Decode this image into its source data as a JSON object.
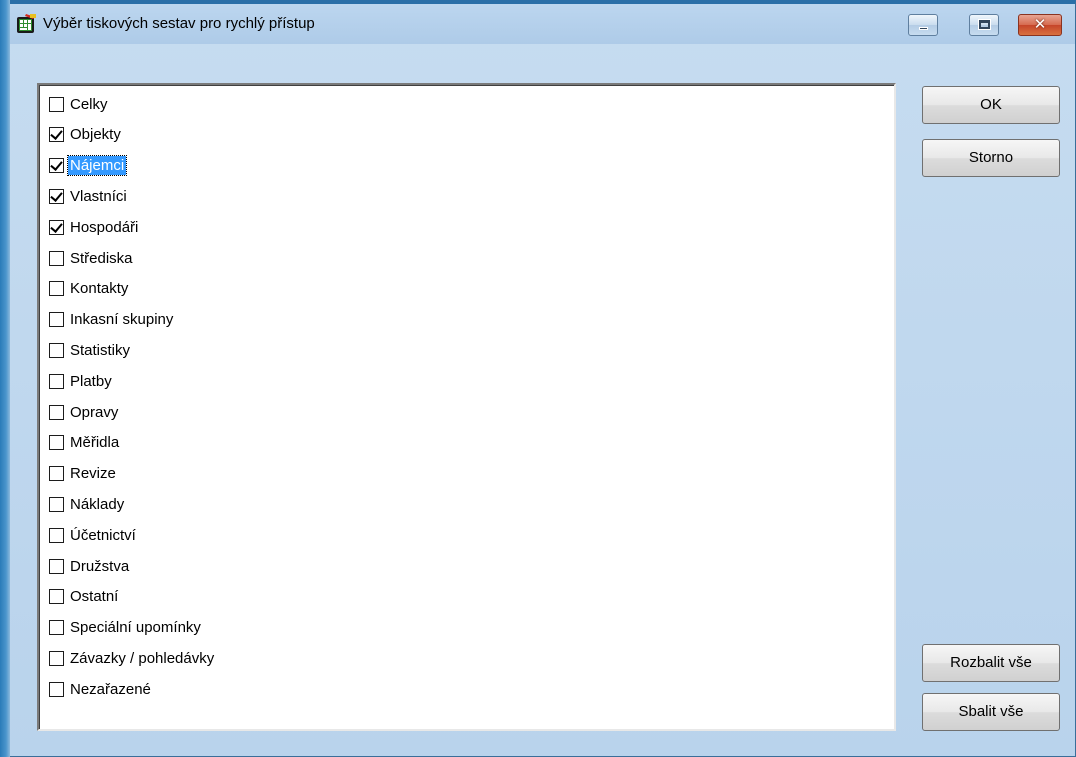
{
  "window": {
    "title": "Výběr tiskových sestav pro rychlý přístup",
    "app_icon": "calculator-app-icon",
    "controls": {
      "minimize": "minimize-icon",
      "maximize": "maximize-icon",
      "close": "close-icon",
      "close_glyph": "✕"
    }
  },
  "list": {
    "items": [
      {
        "label": "Celky",
        "checked": false,
        "selected": false
      },
      {
        "label": "Objekty",
        "checked": true,
        "selected": false
      },
      {
        "label": "Nájemci",
        "checked": true,
        "selected": true
      },
      {
        "label": "Vlastníci",
        "checked": true,
        "selected": false
      },
      {
        "label": "Hospodáři",
        "checked": true,
        "selected": false
      },
      {
        "label": "Střediska",
        "checked": false,
        "selected": false
      },
      {
        "label": "Kontakty",
        "checked": false,
        "selected": false
      },
      {
        "label": "Inkasní skupiny",
        "checked": false,
        "selected": false
      },
      {
        "label": "Statistiky",
        "checked": false,
        "selected": false
      },
      {
        "label": "Platby",
        "checked": false,
        "selected": false
      },
      {
        "label": "Opravy",
        "checked": false,
        "selected": false
      },
      {
        "label": "Měřidla",
        "checked": false,
        "selected": false
      },
      {
        "label": "Revize",
        "checked": false,
        "selected": false
      },
      {
        "label": "Náklady",
        "checked": false,
        "selected": false
      },
      {
        "label": "Účetnictví",
        "checked": false,
        "selected": false
      },
      {
        "label": "Družstva",
        "checked": false,
        "selected": false
      },
      {
        "label": "Ostatní",
        "checked": false,
        "selected": false
      },
      {
        "label": "Speciální upomínky",
        "checked": false,
        "selected": false
      },
      {
        "label": "Závazky / pohledávky",
        "checked": false,
        "selected": false
      },
      {
        "label": "Nezařazené",
        "checked": false,
        "selected": false
      }
    ]
  },
  "buttons": {
    "ok": "OK",
    "storno": "Storno",
    "expand_all": "Rozbalit vše",
    "collapse_all": "Sbalit vše"
  },
  "colors": {
    "selection": "#3399ff",
    "window_bg": "#b9d3ec",
    "close_button": "#c6452a"
  }
}
